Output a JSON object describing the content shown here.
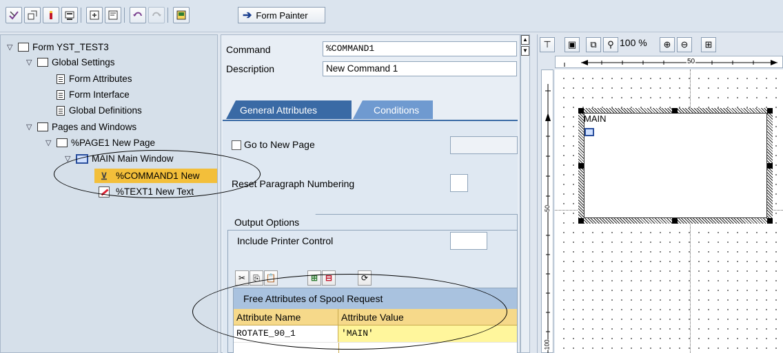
{
  "toolbar": {
    "form_painter_label": "Form Painter"
  },
  "tree": {
    "root": "Form YST_TEST3",
    "global_settings": "Global Settings",
    "form_attributes": "Form Attributes",
    "form_interface": "Form Interface",
    "global_definitions": "Global Definitions",
    "pages_and_windows": "Pages and Windows",
    "page1": "%PAGE1 New Page",
    "main_window": "MAIN Main Window",
    "command1": "%COMMAND1 New",
    "text1": "%TEXT1 New Text"
  },
  "header": {
    "command_label": "Command",
    "command_value": "%COMMAND1",
    "description_label": "Description",
    "description_value": "New Command 1"
  },
  "tabs": {
    "general": "General Attributes",
    "conditions": "Conditions"
  },
  "general": {
    "go_to_new_page": "Go to New Page",
    "reset_paragraph": "Reset Paragraph Numbering"
  },
  "output_options": {
    "title": "Output Options",
    "include_printer_control": "Include Printer Control"
  },
  "spool_table": {
    "title": "Free Attributes of Spool Request",
    "col_name": "Attribute Name",
    "col_value": "Attribute Value",
    "rows": [
      {
        "name": "ROTATE_90_1",
        "value": "'MAIN'"
      }
    ]
  },
  "painter": {
    "zoom": "100 %",
    "ruler_h_mark": "50",
    "ruler_v_mark1": "50",
    "ruler_v_mark2": "100",
    "window_label": "MAIN"
  }
}
